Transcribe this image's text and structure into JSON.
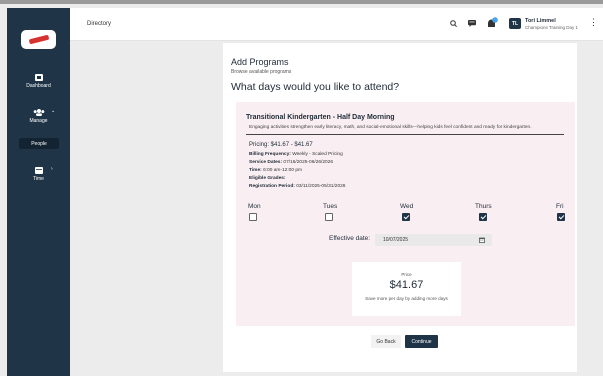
{
  "sidebar": {
    "items": [
      {
        "label": "Dashboard"
      },
      {
        "label": "Manage"
      },
      {
        "label": "People"
      },
      {
        "label": "Time"
      }
    ]
  },
  "topbar": {
    "breadcrumb": "Directory",
    "user": {
      "initials": "TL",
      "name": "Tori Limmel",
      "org": "Champions Training Day 1"
    }
  },
  "page": {
    "title": "Add Programs",
    "subtitle": "Browse available programs",
    "question": "What days would you like to attend?"
  },
  "program": {
    "title": "Transitional Kindergarten - Half Day Morning",
    "description": "Engaging activities strengthen early literacy, math, and social-emotional skills—helping kids feel confident and ready for kindergarten.",
    "pricing": "Pricing: $41.67 - $41.67",
    "details": [
      {
        "label": "Billing Frequency:",
        "value": "Weekly - Scaled Pricing"
      },
      {
        "label": "Service Dates:",
        "value": "07/16/2025-06/26/2026"
      },
      {
        "label": "Time:",
        "value": "6:00 am-12:00 pm"
      },
      {
        "label": "Eligible Grades:",
        "value": ""
      },
      {
        "label": "Registration Period:",
        "value": "03/11/2025-05/31/2026"
      }
    ],
    "days": [
      {
        "label": "Mon",
        "checked": false
      },
      {
        "label": "Tues",
        "checked": false
      },
      {
        "label": "Wed",
        "checked": true
      },
      {
        "label": "Thurs",
        "checked": true
      },
      {
        "label": "Fri",
        "checked": true
      }
    ],
    "effective_date_label": "Effective date:",
    "effective_date_value": "10/07/2025",
    "price_label": "Price",
    "price_value": "$41.67",
    "price_note": "Save more per day by adding more days"
  },
  "actions": {
    "back_label": "Go Back",
    "continue_label": "Continue"
  },
  "colors": {
    "sidebar": "#1f3447",
    "accent": "#1f3447",
    "card_bg": "#f9eff3",
    "logo_red": "#d6322f",
    "notification": "#4aa3e8"
  }
}
